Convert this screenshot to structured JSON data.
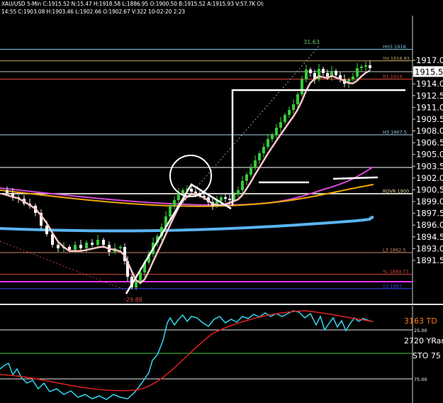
{
  "header": {
    "line1": "XAU/USD  5-Min  C:1915.52  N:15.47  H:1918.58  L:1886.95  O:1900.50  B:1915.52  A:1915.93  V:57.7K  OI:",
    "line2": "14:55  C:1903.08  H:1903.46  L:1902.66  O:1902.67  V:322  10-02-20  2:23"
  },
  "chart_data": [
    {
      "type": "line",
      "name": "price-panel",
      "title": "XAU/USD 5-Min",
      "y_ticks": [
        "1917.00",
        "1914.00",
        "1912.50",
        "1911.00",
        "1909.50",
        "1908.00",
        "1906.50",
        "1905.00",
        "1903.50",
        "1902.00",
        "1900.50",
        "1899.00",
        "1897.50",
        "1896.00",
        "1894.50",
        "1893.00",
        "1891.50"
      ],
      "last_price": "1915.52",
      "level_lines": [
        {
          "label": "HH3 1918.",
          "value": 1918.4,
          "color": "#79c8e8"
        },
        {
          "label": "YH 1916.93",
          "value": 1916.93,
          "color": "#c9a96a"
        },
        {
          "label": "R1 1914.",
          "value": 1914.6,
          "color": "#d84a3a"
        },
        {
          "label": "H3 1907.5",
          "value": 1907.5,
          "color": "#9fd0e0"
        },
        {
          "label": "ROVR 1900",
          "value": 1900.0,
          "color": "#e8d8a0"
        },
        {
          "label": "L3 1892.5",
          "value": 1892.5,
          "color": "#d08a6a"
        },
        {
          "label": "YL 1889.73",
          "value": 1889.73,
          "color": "#d84a3a"
        },
        {
          "label": "S1 1887.",
          "value": 1887.9,
          "color": "#3344ff"
        }
      ],
      "annotations": [
        "31.63",
        "-29.88"
      ]
    },
    {
      "type": "line",
      "name": "oscillator-panel",
      "labels": [
        "3163 TD",
        "2720 YRang",
        "STO  75"
      ],
      "y_ticks": [
        "25.00",
        "75.00"
      ]
    }
  ]
}
